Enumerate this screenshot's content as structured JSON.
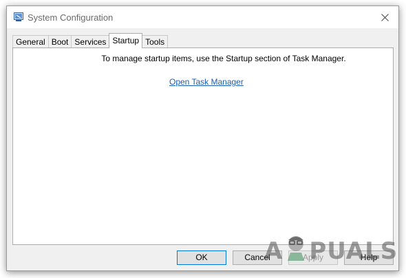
{
  "window": {
    "title": "System Configuration",
    "icon": "msconfig-icon",
    "close_icon": "close-icon"
  },
  "tabs": [
    {
      "label": "General",
      "active": false
    },
    {
      "label": "Boot",
      "active": false
    },
    {
      "label": "Services",
      "active": false
    },
    {
      "label": "Startup",
      "active": true
    },
    {
      "label": "Tools",
      "active": false
    }
  ],
  "startup": {
    "message": "To manage startup items, use the Startup section of Task Manager.",
    "link_label": "Open Task Manager"
  },
  "buttons": {
    "ok": "OK",
    "cancel": "Cancel",
    "apply": "Apply",
    "help": "Help"
  },
  "watermark": {
    "text_left": "A",
    "text_right": "PUALS"
  },
  "colors": {
    "link": "#1a5fb4",
    "default_button_border": "#0078d7",
    "window_bg": "#f0f0f0"
  }
}
